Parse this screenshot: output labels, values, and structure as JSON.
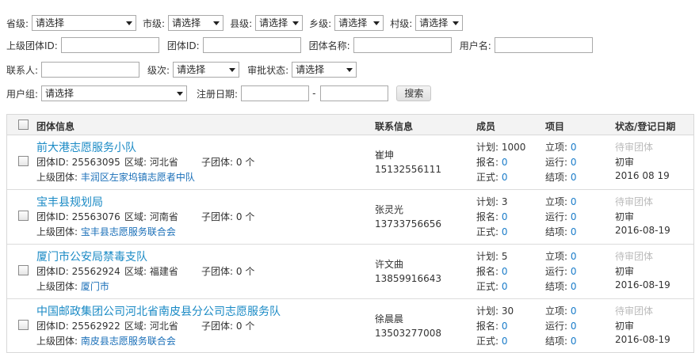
{
  "filters": {
    "province_label": "省级:",
    "province_value": "请选择",
    "city_label": "市级:",
    "city_value": "请选择",
    "county_label": "县级:",
    "county_value": "请选择",
    "town_label": "乡级:",
    "town_value": "请选择",
    "village_label": "村级:",
    "village_value": "请选择",
    "parent_group_id_label": "上级团体ID:",
    "group_id_label": "团体ID:",
    "group_name_label": "团体名称:",
    "username_label": "用户名:",
    "contact_label": "联系人:",
    "level_label": "级次:",
    "level_value": "请选择",
    "approval_label": "审批状态:",
    "approval_value": "请选择",
    "user_group_label": "用户组:",
    "user_group_value": "请选择",
    "reg_date_label": "注册日期:",
    "date_separator": "-",
    "search_button": "搜索"
  },
  "table": {
    "headers": {
      "group_info": "团体信息",
      "contact_info": "联系信息",
      "members": "成员",
      "projects": "项目",
      "status": "状态/登记日期"
    },
    "rows": [
      {
        "name": "前大港志愿服务小队",
        "id_label": "团体ID:",
        "id": "25563095",
        "region_label": "区域:",
        "region": "河北省",
        "sub_label": "子团体:",
        "sub": "0 个",
        "parent_label": "上级团体:",
        "parent": "丰润区左家坞镇志愿者中队",
        "contact_name": "崔坤",
        "contact_phone": "15132556111",
        "plan_label": "计划:",
        "plan": "1000",
        "signup_label": "报名:",
        "signup": "0",
        "formal_label": "正式:",
        "formal": "0",
        "approved_label": "立项:",
        "approved": "0",
        "running_label": "运行:",
        "running": "0",
        "closed_label": "结项:",
        "closed": "0",
        "status_grey": "待审团体",
        "status": "初审",
        "date": "2016 08 19"
      },
      {
        "name": "宝丰县规划局",
        "id_label": "团体ID:",
        "id": "25563076",
        "region_label": "区域:",
        "region": "河南省",
        "sub_label": "子团体:",
        "sub": "0 个",
        "parent_label": "上级团体:",
        "parent": "宝丰县志愿服务联合会",
        "contact_name": "张灵光",
        "contact_phone": "13733756656",
        "plan_label": "计划:",
        "plan": "3",
        "signup_label": "报名:",
        "signup": "0",
        "formal_label": "正式:",
        "formal": "0",
        "approved_label": "立项:",
        "approved": "0",
        "running_label": "运行:",
        "running": "0",
        "closed_label": "结项:",
        "closed": "0",
        "status_grey": "待审团体",
        "status": "初审",
        "date": "2016-08-19"
      },
      {
        "name": "厦门市公安局禁毒支队",
        "id_label": "团体ID:",
        "id": "25562924",
        "region_label": "区域:",
        "region": "福建省",
        "sub_label": "子团体:",
        "sub": "0 个",
        "parent_label": "上级团体:",
        "parent": "厦门市",
        "contact_name": "许文曲",
        "contact_phone": "13859916643",
        "plan_label": "计划:",
        "plan": "5",
        "signup_label": "报名:",
        "signup": "0",
        "formal_label": "正式:",
        "formal": "0",
        "approved_label": "立项:",
        "approved": "0",
        "running_label": "运行:",
        "running": "0",
        "closed_label": "结项:",
        "closed": "0",
        "status_grey": "待审团体",
        "status": "初审",
        "date": "2016-08-19"
      },
      {
        "name": "中国邮政集团公司河北省南皮县分公司志愿服务队",
        "id_label": "团体ID:",
        "id": "25562922",
        "region_label": "区域:",
        "region": "河北省",
        "sub_label": "子团体:",
        "sub": "0 个",
        "parent_label": "上级团体:",
        "parent": "南皮县志愿服务联合会",
        "contact_name": "徐晨晨",
        "contact_phone": "13503277008",
        "plan_label": "计划:",
        "plan": "30",
        "signup_label": "报名:",
        "signup": "0",
        "formal_label": "正式:",
        "formal": "0",
        "approved_label": "立项:",
        "approved": "0",
        "running_label": "运行:",
        "running": "0",
        "closed_label": "结项:",
        "closed": "0",
        "status_grey": "待审团体",
        "status": "初审",
        "date": "2016-08-19"
      }
    ]
  }
}
